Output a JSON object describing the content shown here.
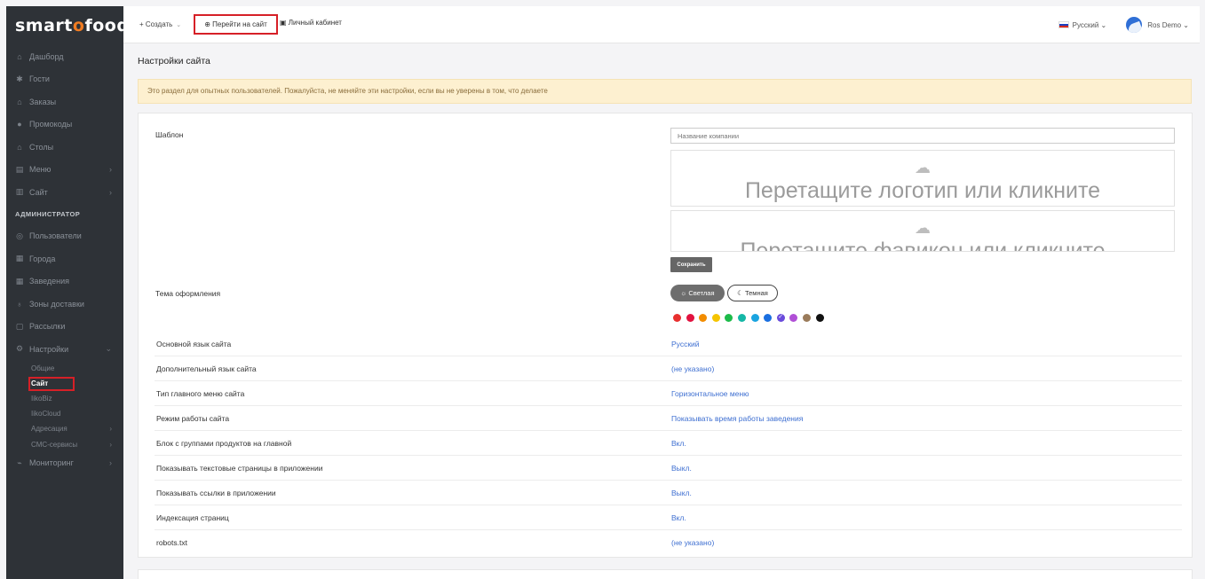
{
  "brand": {
    "logo": "smartofood"
  },
  "colors": {
    "sidebar_bg": "#2e3237",
    "accent_orange": "#f07c22",
    "link": "#3e6fd1",
    "alert_bg": "#fdf0d0",
    "highlight_red": "#d62027"
  },
  "sidebar": {
    "items": [
      {
        "label": "Дашборд",
        "icon": "home-icon",
        "glyph": "⌂"
      },
      {
        "label": "Гости",
        "icon": "person-icon",
        "glyph": "✱"
      },
      {
        "label": "Заказы",
        "icon": "bag-icon",
        "glyph": "⌂"
      },
      {
        "label": "Промокоды",
        "icon": "promo-icon",
        "glyph": "●"
      },
      {
        "label": "Столы",
        "icon": "table-icon",
        "glyph": "⌂"
      },
      {
        "label": "Меню",
        "icon": "menu-icon",
        "glyph": "▤"
      },
      {
        "label": "Сайт",
        "icon": "site-icon",
        "glyph": "▥"
      }
    ],
    "admin_heading": "АДМИНИСТРАТОР",
    "admin_items": [
      {
        "label": "Пользователи",
        "icon": "users-icon",
        "glyph": "◎"
      },
      {
        "label": "Города",
        "icon": "city-icon",
        "glyph": "▦"
      },
      {
        "label": "Заведения",
        "icon": "venue-icon",
        "glyph": "▦"
      },
      {
        "label": "Зоны доставки",
        "icon": "delivery-icon",
        "glyph": "♁"
      },
      {
        "label": "Рассылки",
        "icon": "mail-icon",
        "glyph": "▢"
      },
      {
        "label": "Настройки",
        "icon": "settings-icon",
        "glyph": "⚙"
      }
    ],
    "settings_sub": [
      {
        "label": "Общие"
      },
      {
        "label": "Сайт"
      },
      {
        "label": "IikoBiz"
      },
      {
        "label": "IikoCloud"
      },
      {
        "label": "Адресация"
      },
      {
        "label": "СМС-сервисы"
      }
    ],
    "monitoring": {
      "label": "Мониторинг",
      "icon": "monitoring-icon",
      "glyph": "⌁"
    }
  },
  "topbar": {
    "create": "+ Создать",
    "goto_site": "⊕ Перейти на сайт",
    "cabinet": "▣ Личный кабинет",
    "language": "Русский",
    "user": "Ros Demo"
  },
  "page": {
    "title": "Настройки сайта",
    "alert": "Это раздел для опытных пользователей. Пожалуйста, не меняйте эти настройки, если вы не уверены в том, что делаете"
  },
  "form": {
    "template_label": "Шаблон",
    "company_placeholder": "Название компании",
    "logo_drop": "Перетащите логотип или кликните",
    "favicon_drop": "Перетащите фавикон или кликните",
    "save": "Сохранить",
    "theme_label": "Тема оформления",
    "theme_light": "☼ Светлая",
    "theme_dark": "☾ Темная",
    "swatches": [
      "#e8302f",
      "#e2123f",
      "#f28c00",
      "#f5c400",
      "#1dbb4a",
      "#15b7a6",
      "#1aa4e0",
      "#1a6fe0",
      "#6a4bdb",
      "#b04fd6",
      "#9a7b5a",
      "#111111"
    ],
    "selected_swatch": 8
  },
  "settings": [
    {
      "label": "Основной язык сайта",
      "value": "Русский"
    },
    {
      "label": "Дополнительный язык сайта",
      "value": "(не указано)"
    },
    {
      "label": "Тип главного меню сайта",
      "value": "Горизонтальное меню"
    },
    {
      "label": "Режим работы сайта",
      "value": "Показывать время работы заведения"
    },
    {
      "label": "Блок с группами продуктов на главной",
      "value": "Вкл."
    },
    {
      "label": "Показывать текстовые страницы в приложении",
      "value": "Выкл."
    },
    {
      "label": "Показывать ссылки в приложении",
      "value": "Выкл."
    },
    {
      "label": "Индексация страниц",
      "value": "Вкл."
    },
    {
      "label": "robots.txt",
      "value": "(не указано)"
    }
  ]
}
